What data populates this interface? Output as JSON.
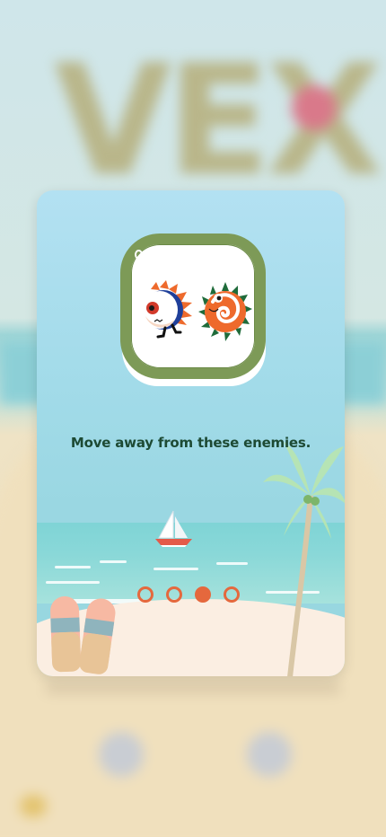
{
  "background": {
    "game_title": "VEX"
  },
  "tutorial": {
    "caption": "Move away from these enemies.",
    "enemies": [
      {
        "name": "spiky-cyclops-enemy",
        "color": "#1f3f9a"
      },
      {
        "name": "spiky-chameleon-enemy",
        "color": "#ee6a2c"
      }
    ],
    "pager": {
      "total_pages": 4,
      "current_page": 3,
      "dot_color": "#e5683d"
    }
  },
  "colors": {
    "frame": "#7d9a57",
    "caption": "#1d4a34",
    "sky": "#b3e1f2",
    "sea": "#8ad8d8",
    "sand": "#fbeee2"
  }
}
